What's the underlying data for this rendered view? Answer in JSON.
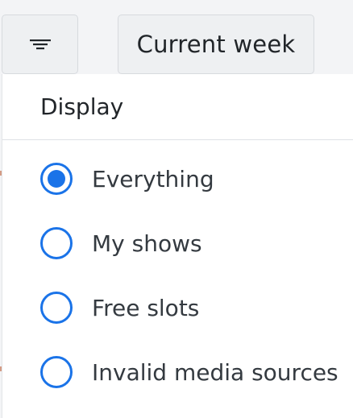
{
  "toolbar": {
    "filter_button_icon": "filter-lines-icon",
    "current_week_label": "Current week"
  },
  "menu": {
    "header": "Display",
    "options": [
      {
        "label": "Everything",
        "checked": true
      },
      {
        "label": "My shows",
        "checked": false
      },
      {
        "label": "Free slots",
        "checked": false
      },
      {
        "label": "Invalid media sources",
        "checked": false
      }
    ]
  },
  "colors": {
    "accent": "#1a73e8",
    "button_bg": "#eef0f2"
  }
}
